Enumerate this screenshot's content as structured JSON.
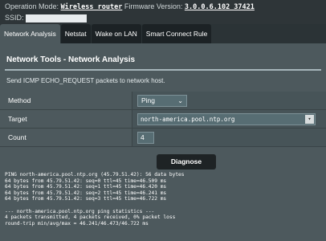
{
  "header": {
    "op_mode_label": "Operation Mode:",
    "op_mode_value": "Wireless router",
    "firmware_label": "Firmware Version:",
    "firmware_value": "3.0.0.6.102_37421",
    "ssid_label": "SSID:"
  },
  "tabs": [
    {
      "label": "Network Analysis",
      "active": true
    },
    {
      "label": "Netstat",
      "active": false
    },
    {
      "label": "Wake on LAN",
      "active": false
    },
    {
      "label": "Smart Connect Rule",
      "active": false
    }
  ],
  "main": {
    "title": "Network Tools - Network Analysis",
    "description": "Send ICMP ECHO_REQUEST packets to network host.",
    "method_label": "Method",
    "method_value": "Ping",
    "target_label": "Target",
    "target_value": "north-america.pool.ntp.org",
    "count_label": "Count",
    "count_value": "4",
    "diagnose_label": "Diagnose"
  },
  "console": {
    "lines": [
      "PING north-america.pool.ntp.org (45.79.51.42): 56 data bytes",
      "64 bytes from 45.79.51.42: seq=0 ttl=45 time=46.509 ms",
      "64 bytes from 45.79.51.42: seq=1 ttl=45 time=46.420 ms",
      "64 bytes from 45.79.51.42: seq=2 ttl=45 time=46.241 ms",
      "64 bytes from 45.79.51.42: seq=3 ttl=45 time=46.722 ms",
      "",
      "--- north-america.pool.ntp.org ping statistics ---",
      "4 packets transmitted, 4 packets received, 0% packet loss",
      "round-trip min/avg/max = 46.241/46.473/46.722 ms"
    ]
  },
  "colors": {
    "background": "#2b3336",
    "panel": "#4d595d",
    "tab_inactive": "#1c2225",
    "button": "#1e2325"
  }
}
